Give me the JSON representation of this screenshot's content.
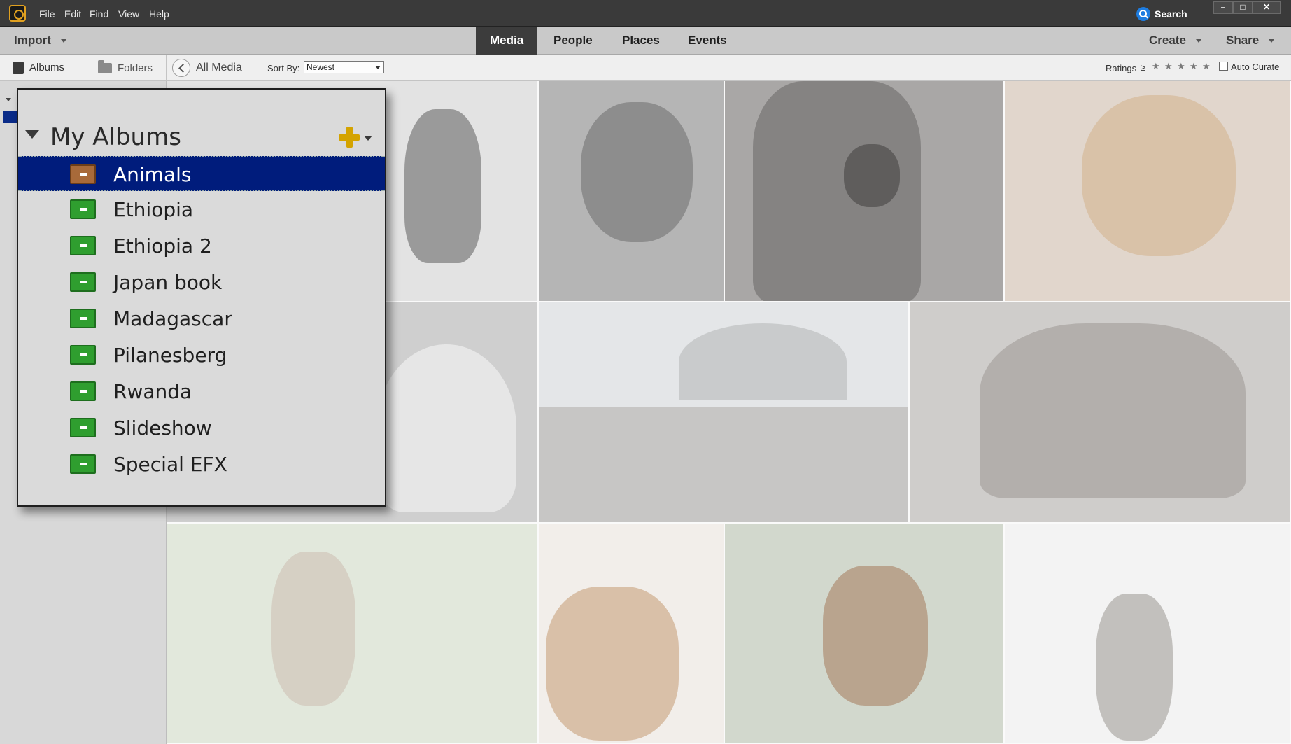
{
  "titlebar": {
    "menus": [
      "File",
      "Edit",
      "Find",
      "View",
      "Help"
    ],
    "search_label": "Search",
    "window_controls": [
      "minimize-icon",
      "maximize-icon",
      "close-icon"
    ]
  },
  "modebar": {
    "import_label": "Import",
    "tabs": [
      "Media",
      "People",
      "Places",
      "Events"
    ],
    "active_tab": "Media",
    "create_label": "Create",
    "share_label": "Share"
  },
  "toolbar": {
    "albums_tab": "Albums",
    "folders_tab": "Folders",
    "back_label": "All Media",
    "sort_label": "Sort By:",
    "sort_value": "Newest",
    "ratings_label": "Ratings",
    "ratings_op": "≥",
    "stars": [
      "★",
      "★",
      "★",
      "★",
      "★"
    ],
    "auto_curate_label": "Auto Curate"
  },
  "albums_popup": {
    "title": "My Albums",
    "selected": "Animals",
    "items": [
      "Animals",
      "Ethiopia",
      "Ethiopia 2",
      "Japan book",
      "Madagascar",
      "Pilanesberg",
      "Rwanda",
      "Slideshow",
      "Special EFX"
    ]
  },
  "colors": {
    "selection": "#001c7c",
    "album_icon": "#2f9e2f",
    "plus_icon": "#d4a300",
    "search_badge": "#1d7ce0"
  }
}
